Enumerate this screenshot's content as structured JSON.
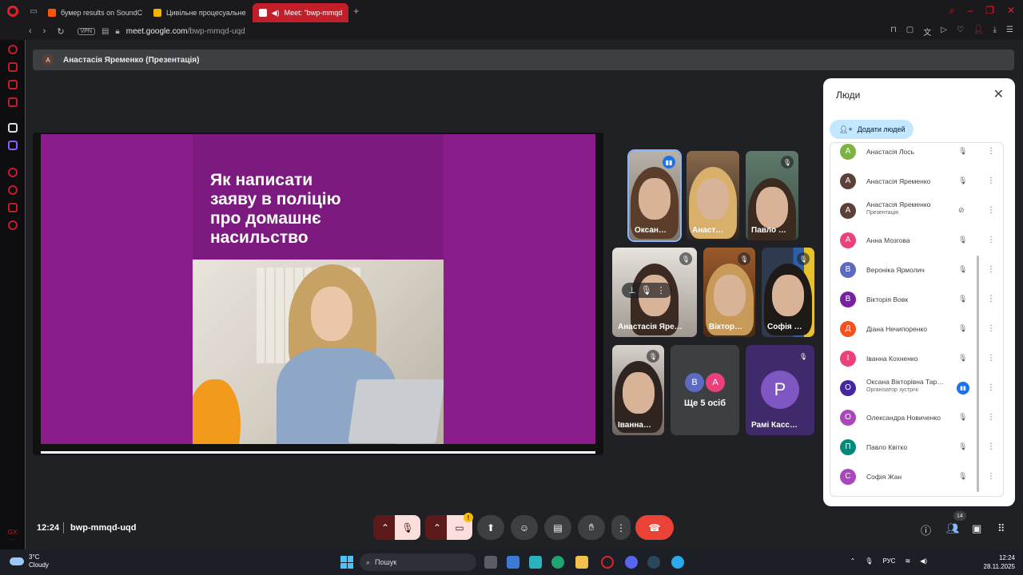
{
  "browser": {
    "tabs": [
      {
        "label": "бумер results on SoundC",
        "active": false,
        "icon_color": "#ff5500"
      },
      {
        "label": "Цивільне процесуальне",
        "active": false,
        "icon_color": "#f4b400"
      },
      {
        "label": "Meet: \"bwp-mmqd",
        "active": true,
        "icon_color": "#c21f2a"
      }
    ],
    "new_tab": "+",
    "vpn_label": "VPN",
    "url_host": "meet.google.com",
    "url_path": "/bwp-mmqd-uqd"
  },
  "meet": {
    "presenter_bar": {
      "avatar_letter": "А",
      "text": "Анастасія Яременко (Презентація)"
    },
    "slide": {
      "title_lines": [
        "Як написати",
        "заяву в поліцію",
        "про домашнє",
        "насильство"
      ]
    },
    "tiles": [
      {
        "name": "Оксан…",
        "status": "speaking"
      },
      {
        "name": "Анаст…",
        "status": "none"
      },
      {
        "name": "Павло …",
        "status": "muted"
      },
      {
        "name": "Анастасія Яре…",
        "status": "muted"
      },
      {
        "name": "Віктор…",
        "status": "muted"
      },
      {
        "name": "Софія …",
        "status": "muted"
      },
      {
        "name": "Іванна…",
        "status": "muted"
      },
      {
        "more_label": "Ще 5 осіб",
        "avatars": [
          {
            "letter": "В",
            "color": "#5c6bc0"
          },
          {
            "letter": "А",
            "color": "#ec407a"
          }
        ]
      },
      {
        "name": "Рамі Касс…",
        "avatar_letter": "Р",
        "status": "muted"
      }
    ],
    "people_panel": {
      "title": "Люди",
      "add_button": "Додати людей",
      "people": [
        {
          "letter": "А",
          "color": "#7cb342",
          "name": "Анастасія Лось",
          "sub": "",
          "status": "muted"
        },
        {
          "letter": "А",
          "color": "#5d4037",
          "name": "Анастасія Яременко",
          "sub": "",
          "status": "muted"
        },
        {
          "letter": "А",
          "color": "#5d4037",
          "name": "Анастасія Яременко",
          "sub": "Презентація",
          "status": "presenting"
        },
        {
          "letter": "А",
          "color": "#ec407a",
          "name": "Анна Мозгова",
          "sub": "",
          "status": "muted"
        },
        {
          "letter": "В",
          "color": "#5c6bc0",
          "name": "Вероніка Ярмолич",
          "sub": "",
          "status": "muted"
        },
        {
          "letter": "В",
          "color": "#7b1fa2",
          "name": "Вікторія Вовк",
          "sub": "",
          "status": "muted"
        },
        {
          "letter": "Д",
          "color": "#f4511e",
          "name": "Діана Нечипоренко",
          "sub": "",
          "status": "muted"
        },
        {
          "letter": "І",
          "color": "#ec407a",
          "name": "Іванна Кохненко",
          "sub": "",
          "status": "muted"
        },
        {
          "letter": "О",
          "color": "#4527a0",
          "name": "Оксана Вікторівна Тар…",
          "sub": "Організатор зустрічі",
          "status": "speaking"
        },
        {
          "letter": "О",
          "color": "#ab47bc",
          "name": "Олександра Новиченко",
          "sub": "",
          "status": "muted"
        },
        {
          "letter": "П",
          "color": "#00897b",
          "name": "Павло Квітко",
          "sub": "",
          "status": "muted"
        },
        {
          "letter": "С",
          "color": "#ab47bc",
          "name": "Софія Жан",
          "sub": "",
          "status": "muted"
        }
      ]
    },
    "bottom": {
      "time": "12:24",
      "meeting_code": "bwp-mmqd-uqd",
      "people_count": "14",
      "warn": "!"
    }
  },
  "taskbar": {
    "temp": "3°C",
    "weather": "Cloudy",
    "search_placeholder": "Пошук",
    "lang": "РУС",
    "time": "12:24",
    "date": "28.11.2025"
  }
}
